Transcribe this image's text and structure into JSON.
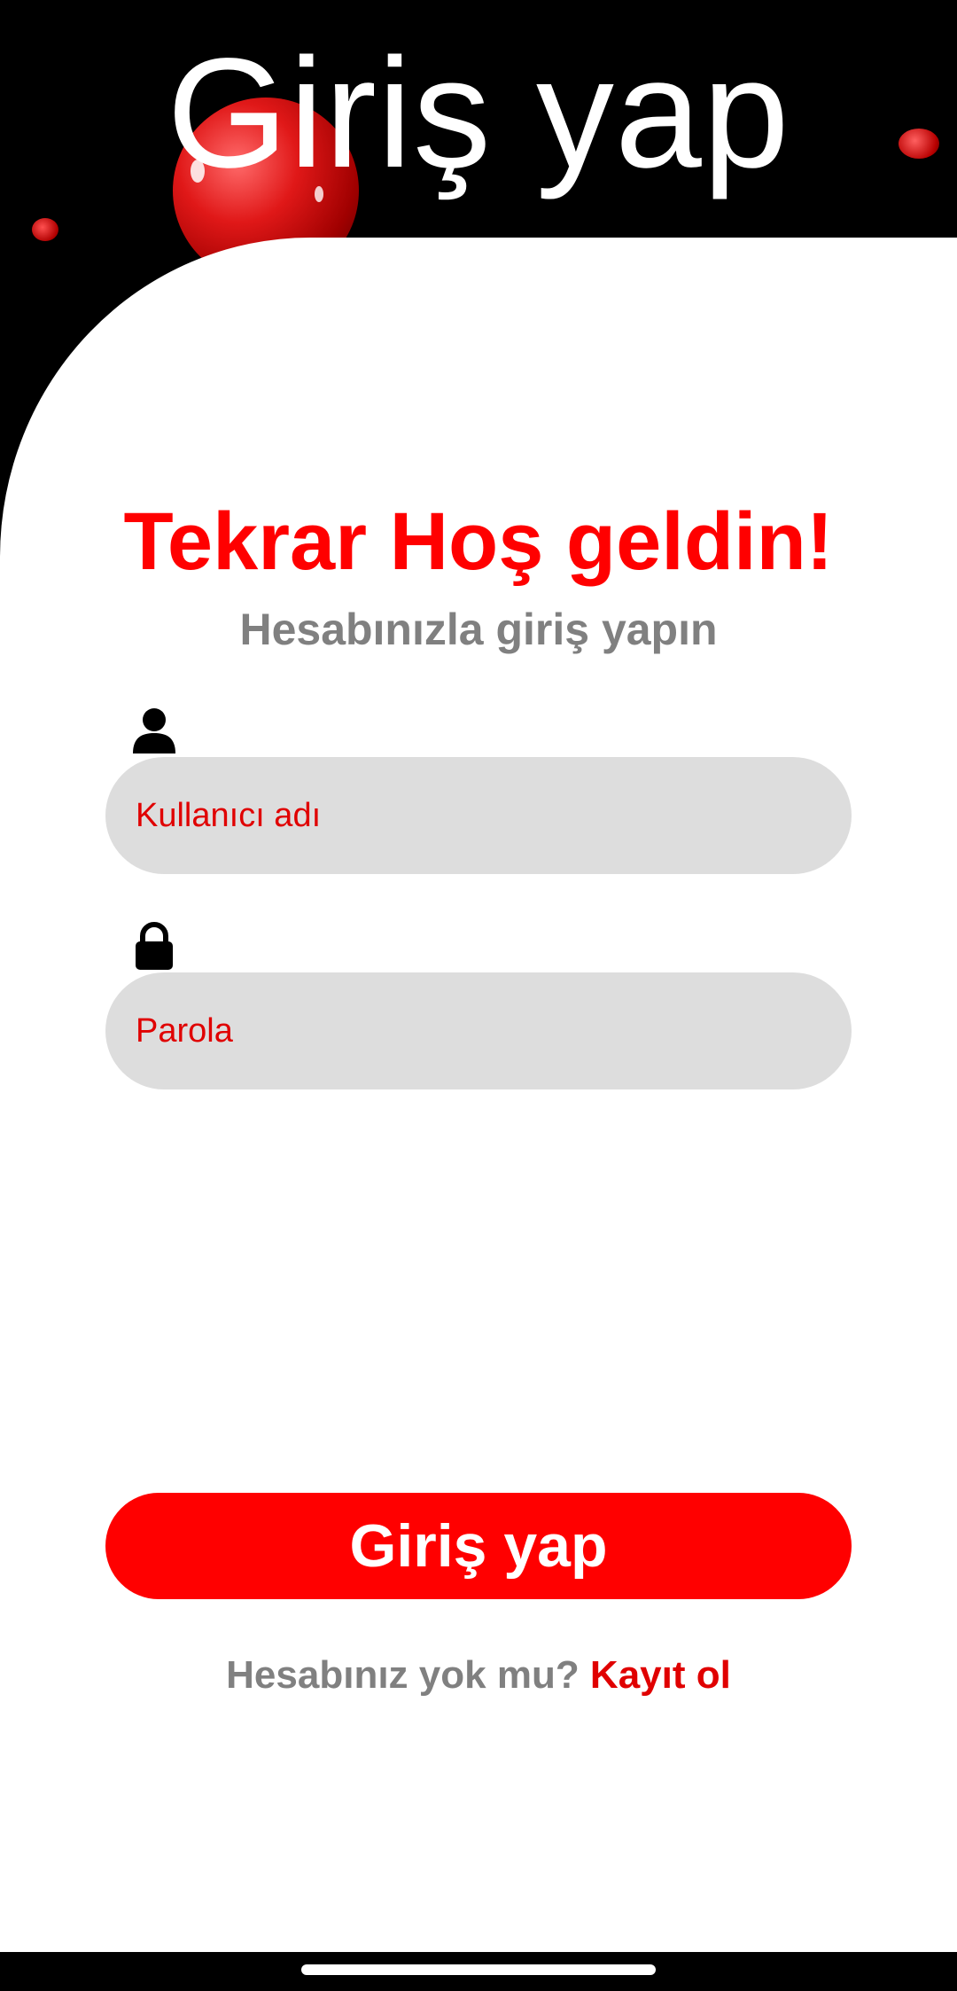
{
  "header": {
    "title": "Giriş yap"
  },
  "welcome": {
    "title": "Tekrar Hoş geldin!",
    "subtitle": "Hesabınızla giriş yapın"
  },
  "form": {
    "username": {
      "icon": "person-icon",
      "placeholder": "Kullanıcı adı",
      "value": ""
    },
    "password": {
      "icon": "lock-icon",
      "placeholder": "Parola",
      "value": ""
    },
    "submit_label": "Giriş yap"
  },
  "signup": {
    "prompt": "Hesabınız yok mu?",
    "link": "Kayıt ol"
  },
  "colors": {
    "accent": "#ff0000",
    "header_background": "#000000",
    "card_background": "#ffffff",
    "field_background": "#dddddd",
    "muted_text": "#808080"
  }
}
